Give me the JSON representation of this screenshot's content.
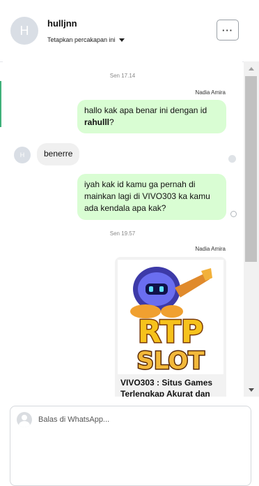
{
  "contact": {
    "avatar_initial": "H",
    "name": "hulljnn",
    "subtitle": "Tetapkan percakapan ini",
    "menu_label": "···"
  },
  "messages": [
    {
      "type": "time",
      "text": "Sen 17.14"
    },
    {
      "type": "sender",
      "text": "Nadia Amira"
    },
    {
      "type": "out",
      "text_plain": "hallo kak apa benar ini  dengan id ",
      "text_bold": "rahulll",
      "text_end": "?"
    },
    {
      "type": "in",
      "avatar_initial": "H",
      "text": "benerre"
    },
    {
      "type": "out",
      "text": "iyah kak id kamu ga pernah di mainkan lagi di VIVO303 ka kamu ada kendala apa kak?"
    },
    {
      "type": "time",
      "text": "Sen 19.57"
    },
    {
      "type": "sender",
      "text": "Nadia Amira"
    },
    {
      "type": "card",
      "image_text_top": "RTP",
      "image_text_bottom": "SLOT",
      "title": "VIVO303 : Situs Games Terlengkap Akurat dan"
    }
  ],
  "reply": {
    "placeholder": "Balas di WhatsApp..."
  },
  "colors": {
    "outgoing_bubble": "#d9fdd3",
    "incoming_bubble": "#f0f0f0",
    "accent": "#3fb07a"
  }
}
